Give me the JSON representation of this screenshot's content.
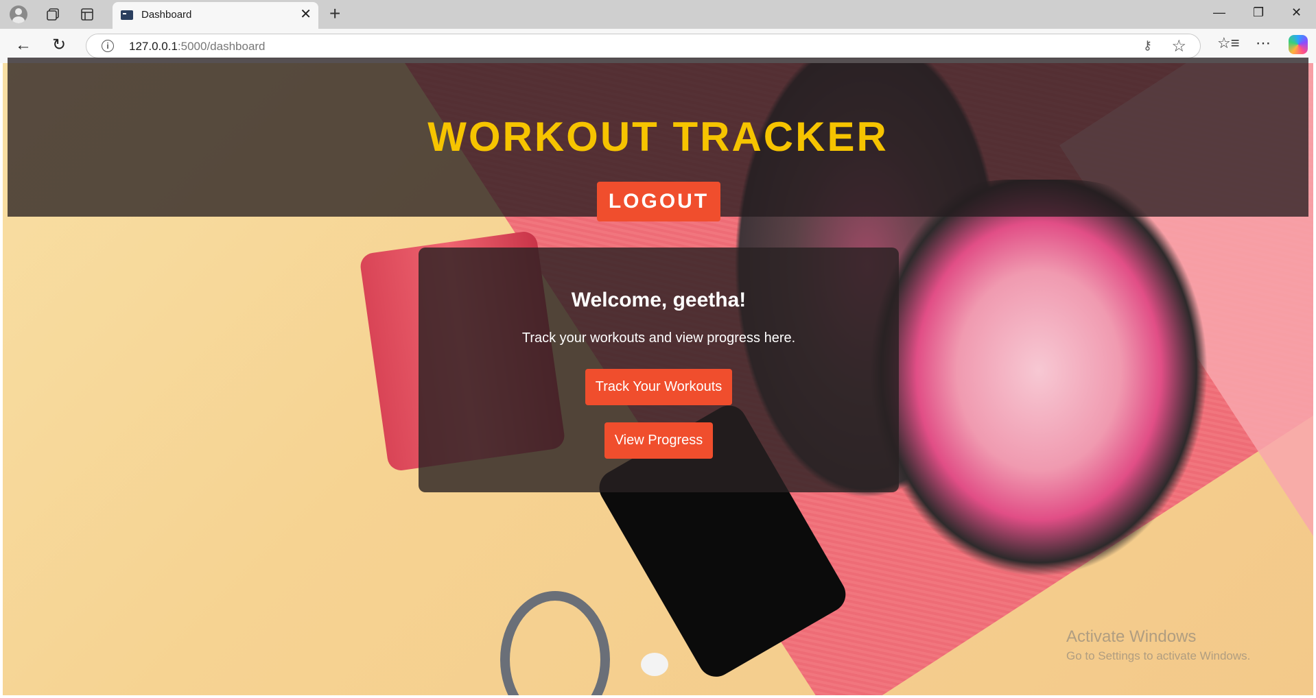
{
  "browser": {
    "tab_title": "Dashboard",
    "url_host": "127.0.0.1",
    "url_path": ":5000/dashboard"
  },
  "icons": {
    "profile": "profile-icon",
    "workspaces": "workspaces-icon",
    "tab_actions": "tab-actions-icon",
    "back": "back-arrow-icon",
    "refresh": "refresh-icon",
    "info": "info-icon",
    "key": "key-icon",
    "favorite": "star-icon",
    "favorites": "favorites-icon",
    "more": "more-icon",
    "copilot": "copilot-icon"
  },
  "header": {
    "title": "WORKOUT TRACKER",
    "logout_label": "LOGOUT"
  },
  "card": {
    "welcome": "Welcome, geetha!",
    "subtitle": "Track your workouts and view progress here.",
    "track_label": "Track Your Workouts",
    "progress_label": "View Progress"
  },
  "watermark": {
    "line1": "Activate Windows",
    "line2": "Go to Settings to activate Windows."
  },
  "colors": {
    "title": "#f6c400",
    "button": "#f04e2d",
    "overlay": "rgba(35,28,30,0.76)"
  }
}
